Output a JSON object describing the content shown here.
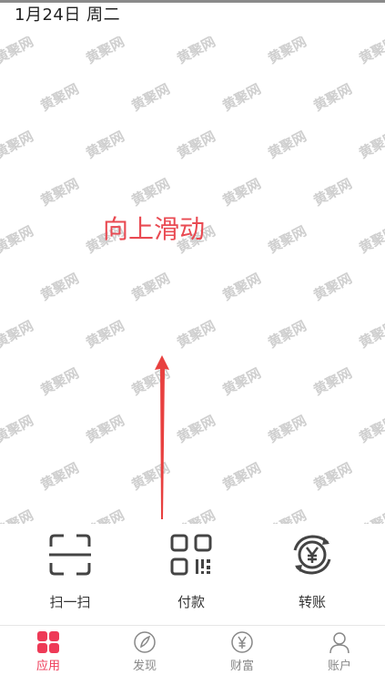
{
  "status": {
    "date": "1月24日 周二"
  },
  "watermark": {
    "text": "黄聚网"
  },
  "hint": {
    "text": "向上滑动",
    "color": "#e94a52"
  },
  "actions": [
    {
      "label": "扫一扫",
      "icon": "scan-icon"
    },
    {
      "label": "付款",
      "icon": "qr-code-icon"
    },
    {
      "label": "转账",
      "icon": "transfer-yen-icon"
    }
  ],
  "tabs": [
    {
      "label": "应用",
      "icon": "apps-grid-icon",
      "active": true
    },
    {
      "label": "发现",
      "icon": "compass-icon",
      "active": false
    },
    {
      "label": "财富",
      "icon": "yen-circle-icon",
      "active": false
    },
    {
      "label": "账户",
      "icon": "user-icon",
      "active": false
    }
  ],
  "colors": {
    "accent": "#ee3a57",
    "arrow": "#e8403f",
    "icon": "#444444"
  }
}
